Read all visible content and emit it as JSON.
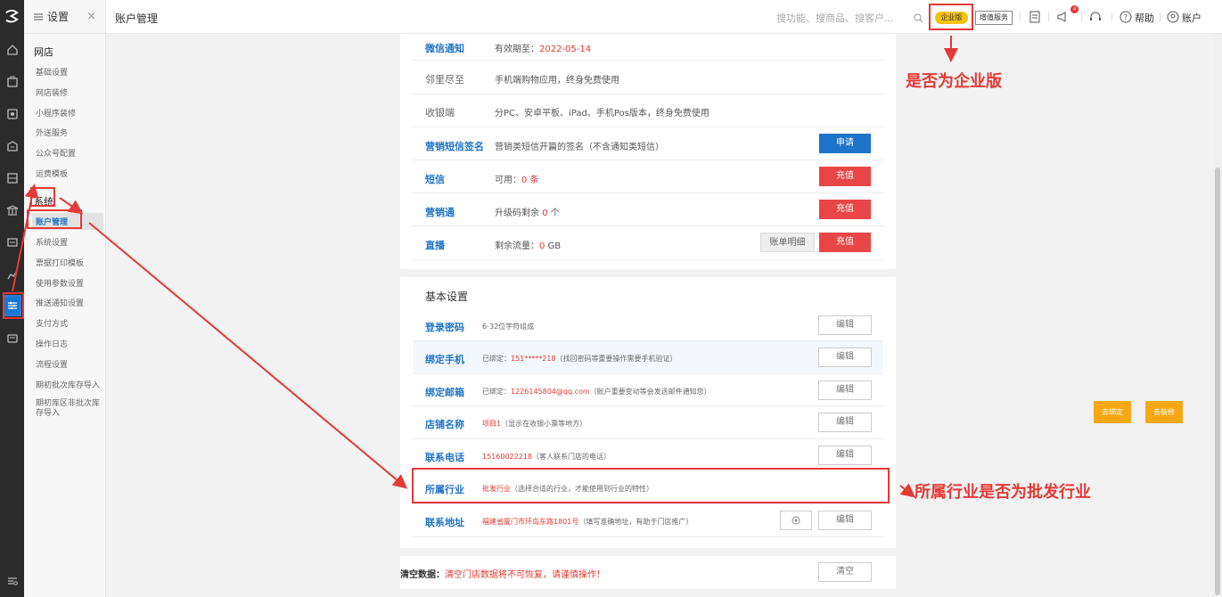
{
  "sidebar": {
    "header": "设置",
    "groups": [
      {
        "title": "网店",
        "items": [
          "基础设置",
          "网店装修",
          "小程序装修",
          "外送服务",
          "公众号配置",
          "运费模板"
        ]
      },
      {
        "title": "系统",
        "items": [
          "账户管理",
          "系统设置",
          "票据打印模板",
          "使用参数设置",
          "推送通知设置",
          "支付方式",
          "操作日志",
          "流程设置",
          "期初批次库存导入",
          "期初库区非批次库存导入"
        ]
      }
    ]
  },
  "topbar": {
    "title": "账户管理",
    "search_placeholder": "搜功能、搜商品、搜客户...",
    "edition_badge": "企业版",
    "value_added": "增值服务",
    "notif_count": "4",
    "help": "帮助",
    "account": "账户"
  },
  "services": [
    {
      "label": "微信通知",
      "style": "blue",
      "desc_prefix": "有效期至：",
      "desc_red": "2022-05-14",
      "desc_suffix": ""
    },
    {
      "label": "邻里尽至",
      "style": "gray",
      "desc_prefix": "手机端购物应用，终身免费使用",
      "desc_red": "",
      "desc_suffix": ""
    },
    {
      "label": "收银端",
      "style": "gray",
      "desc_prefix": "分PC、安卓平板、iPad、手机Pos版本，终身免费使用",
      "desc_red": "",
      "desc_suffix": ""
    },
    {
      "label": "营销短信签名",
      "style": "blue",
      "desc_prefix": "营销类短信开篇的签名（不含通知类短信）",
      "desc_red": "",
      "desc_suffix": "",
      "button": "申请"
    },
    {
      "label": "短信",
      "style": "blue",
      "desc_prefix": "可用：",
      "desc_red": "0 条",
      "desc_suffix": "",
      "button": "充值"
    },
    {
      "label": "营销通",
      "style": "blue",
      "desc_prefix": "升级码剩余 ",
      "desc_red": "0",
      "desc_suffix": " 个",
      "button": "充值"
    },
    {
      "label": "直播",
      "style": "blue",
      "desc_prefix": "剩余流量：",
      "desc_red": "0",
      "desc_suffix": " GB",
      "button": "充值",
      "extra_button": "账单明细"
    }
  ],
  "basic": {
    "title": "基本设置",
    "edit_label": "编辑",
    "rows": [
      {
        "label": "登录密码",
        "value": "6-32位字符组成",
        "value_red": false,
        "hint": ""
      },
      {
        "label": "绑定手机",
        "value": "已绑定：",
        "red": "151*****218",
        "hint": "（找回密码等重要操作需要手机验证）"
      },
      {
        "label": "绑定邮箱",
        "value": "已绑定：",
        "red": "1226145804@qq.com",
        "hint": "（账户重要变动等会发送邮件通知您）"
      },
      {
        "label": "店铺名称",
        "value": "",
        "red": "项目1",
        "hint": "（显示在收银小票等地方）"
      },
      {
        "label": "联系电话",
        "value": "",
        "red": "15160022218",
        "hint": "（客人联系门店的电话）"
      },
      {
        "label": "所属行业",
        "value": "",
        "red": "批发行业",
        "hint": "（选择合适的行业，才能使用到行业的特性）"
      },
      {
        "label": "联系地址",
        "value": "",
        "red": "福建省厦门市环岛东路1801号",
        "hint": "（填写准确地址，有助于门店推广）"
      }
    ]
  },
  "clear": {
    "label": "清空数据：",
    "warning": "清空门店数据将不可恢复，请谨慎操作！",
    "button": "清空"
  },
  "side_buttons": {
    "bind": "去绑定",
    "decorate": "去装修"
  },
  "annotations": {
    "enterprise": "是否为企业版",
    "industry": "所属行业是否为批发行业"
  },
  "colors": {
    "accent": "#1e74c9",
    "danger": "#e84646",
    "annotation": "#e53935",
    "badge": "#f3c20c"
  }
}
